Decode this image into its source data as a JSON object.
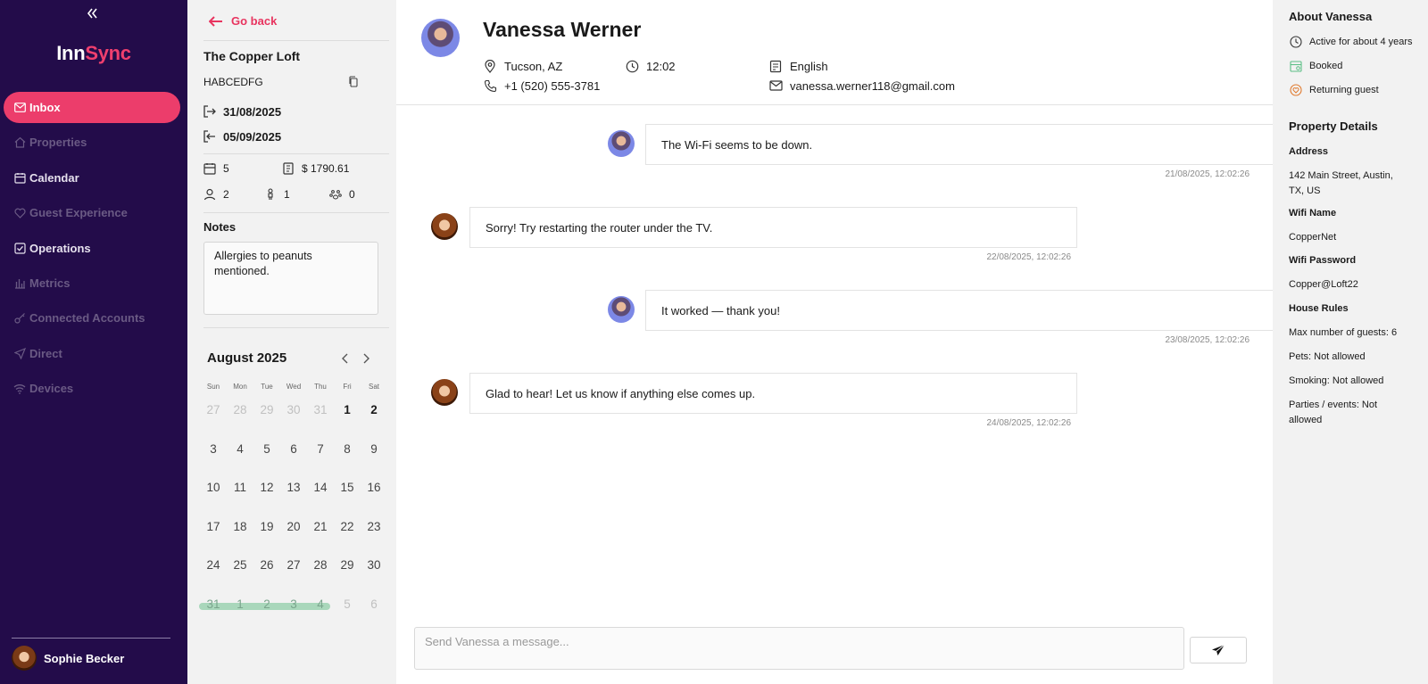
{
  "app": {
    "logo_part1": "Inn",
    "logo_part2": "Sync"
  },
  "nav": [
    {
      "label": "Inbox",
      "icon": "mail-icon",
      "state": "active"
    },
    {
      "label": "Properties",
      "icon": "home-icon",
      "state": "dim"
    },
    {
      "label": "Calendar",
      "icon": "calendar-icon",
      "state": "bright"
    },
    {
      "label": "Guest Experience",
      "icon": "heart-icon",
      "state": "dim"
    },
    {
      "label": "Operations",
      "icon": "checkbox-icon",
      "state": "bright"
    },
    {
      "label": "Metrics",
      "icon": "bar-chart-icon",
      "state": "dim"
    },
    {
      "label": "Connected Accounts",
      "icon": "key-icon",
      "state": "dim"
    },
    {
      "label": "Direct",
      "icon": "send-icon",
      "state": "dim"
    },
    {
      "label": "Devices",
      "icon": "wifi-icon",
      "state": "dim"
    }
  ],
  "sidebar_user": {
    "name": "Sophie Becker"
  },
  "reservation": {
    "go_back": "Go back",
    "property": "The Copper Loft",
    "code": "HABCEDFG",
    "check_in": "31/08/2025",
    "check_out": "05/09/2025",
    "nights": "5",
    "total": "$ 1790.61",
    "adults": "2",
    "children": "1",
    "pets": "0",
    "notes_title": "Notes",
    "notes": "Allergies to peanuts mentioned."
  },
  "calendar": {
    "title": "August 2025",
    "weekdays": [
      "Sun",
      "Mon",
      "Tue",
      "Wed",
      "Thu",
      "Fri",
      "Sat"
    ],
    "weeks": [
      [
        {
          "d": "27",
          "s": "muted"
        },
        {
          "d": "28",
          "s": "muted"
        },
        {
          "d": "29",
          "s": "muted"
        },
        {
          "d": "30",
          "s": "muted"
        },
        {
          "d": "31",
          "s": "muted"
        },
        {
          "d": "1",
          "s": "b"
        },
        {
          "d": "2",
          "s": "b"
        }
      ],
      [
        {
          "d": "3",
          "s": ""
        },
        {
          "d": "4",
          "s": ""
        },
        {
          "d": "5",
          "s": ""
        },
        {
          "d": "6",
          "s": ""
        },
        {
          "d": "7",
          "s": ""
        },
        {
          "d": "8",
          "s": ""
        },
        {
          "d": "9",
          "s": ""
        }
      ],
      [
        {
          "d": "10",
          "s": ""
        },
        {
          "d": "11",
          "s": ""
        },
        {
          "d": "12",
          "s": ""
        },
        {
          "d": "13",
          "s": ""
        },
        {
          "d": "14",
          "s": ""
        },
        {
          "d": "15",
          "s": ""
        },
        {
          "d": "16",
          "s": ""
        }
      ],
      [
        {
          "d": "17",
          "s": ""
        },
        {
          "d": "18",
          "s": ""
        },
        {
          "d": "19",
          "s": ""
        },
        {
          "d": "20",
          "s": ""
        },
        {
          "d": "21",
          "s": ""
        },
        {
          "d": "22",
          "s": ""
        },
        {
          "d": "23",
          "s": ""
        }
      ],
      [
        {
          "d": "24",
          "s": ""
        },
        {
          "d": "25",
          "s": ""
        },
        {
          "d": "26",
          "s": ""
        },
        {
          "d": "27",
          "s": ""
        },
        {
          "d": "28",
          "s": ""
        },
        {
          "d": "29",
          "s": ""
        },
        {
          "d": "30",
          "s": ""
        }
      ],
      [
        {
          "d": "31",
          "s": "hl"
        },
        {
          "d": "1",
          "s": "hl"
        },
        {
          "d": "2",
          "s": "hl"
        },
        {
          "d": "3",
          "s": "hl"
        },
        {
          "d": "4",
          "s": "hl"
        },
        {
          "d": "5",
          "s": "muted"
        },
        {
          "d": "6",
          "s": "muted"
        }
      ]
    ]
  },
  "guest": {
    "name": "Vanessa Werner",
    "location": "Tucson, AZ",
    "local_time": "12:02",
    "language": "English",
    "phone": "+1 (520) 555-3781",
    "email": "vanessa.werner118@gmail.com"
  },
  "messages": [
    {
      "from": "guest",
      "text": "The Wi-Fi seems to be down.",
      "time": "21/08/2025, 12:02:26"
    },
    {
      "from": "host",
      "text": "Sorry! Try restarting the router under the TV.",
      "time": "22/08/2025, 12:02:26"
    },
    {
      "from": "guest",
      "text": "It worked — thank you!",
      "time": "23/08/2025, 12:02:26"
    },
    {
      "from": "host",
      "text": "Glad to hear! Let us know if anything else comes up.",
      "time": "24/08/2025, 12:02:26"
    }
  ],
  "composer": {
    "placeholder": "Send Vanessa a message..."
  },
  "about": {
    "title": "About Vanessa",
    "active": "Active for about 4 years",
    "status": "Booked",
    "returning": "Returning guest"
  },
  "property_details": {
    "title": "Property Details",
    "address_label": "Address",
    "address": "142 Main Street, Austin, TX, US",
    "wifi_name_label": "Wifi Name",
    "wifi_name": "CopperNet",
    "wifi_password_label": "Wifi Password",
    "wifi_password": "Copper@Loft22",
    "house_rules_label": "House Rules",
    "rules": [
      "Max number of guests: 6",
      "Pets: Not allowed",
      "Smoking: Not allowed",
      "Parties / events: Not allowed"
    ]
  },
  "colors": {
    "sidebar_bg": "#230c4a",
    "accent": "#ec3d6b",
    "stay_highlight": "#a9d7bb"
  }
}
